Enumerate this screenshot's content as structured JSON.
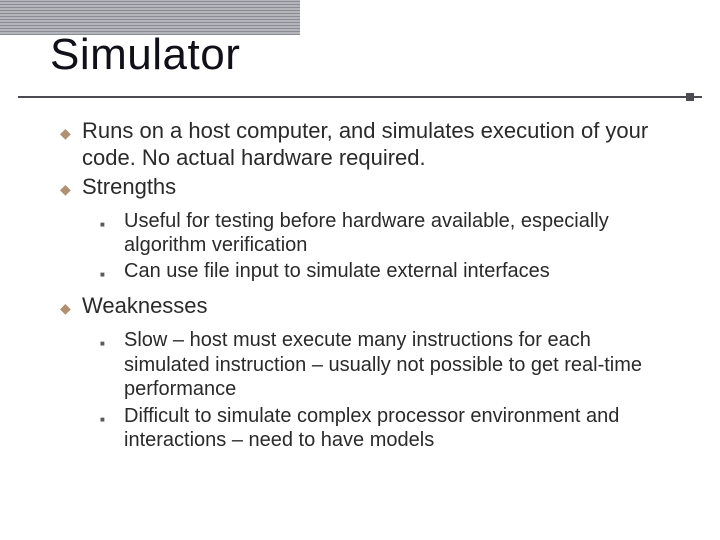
{
  "title": "Simulator",
  "bullets": {
    "b0": "Runs on a host computer, and simulates execution of your code. No actual hardware required.",
    "b1": "Strengths",
    "b1_subs": {
      "s0": "Useful for testing before hardware available, especially algorithm verification",
      "s1": "Can use file input to simulate external interfaces"
    },
    "b2": "Weaknesses",
    "b2_subs": {
      "s0": "Slow – host must execute many instructions for each simulated instruction – usually not possible to get real-time performance",
      "s1": "Difficult to simulate complex processor environment and interactions – need to have models"
    }
  }
}
